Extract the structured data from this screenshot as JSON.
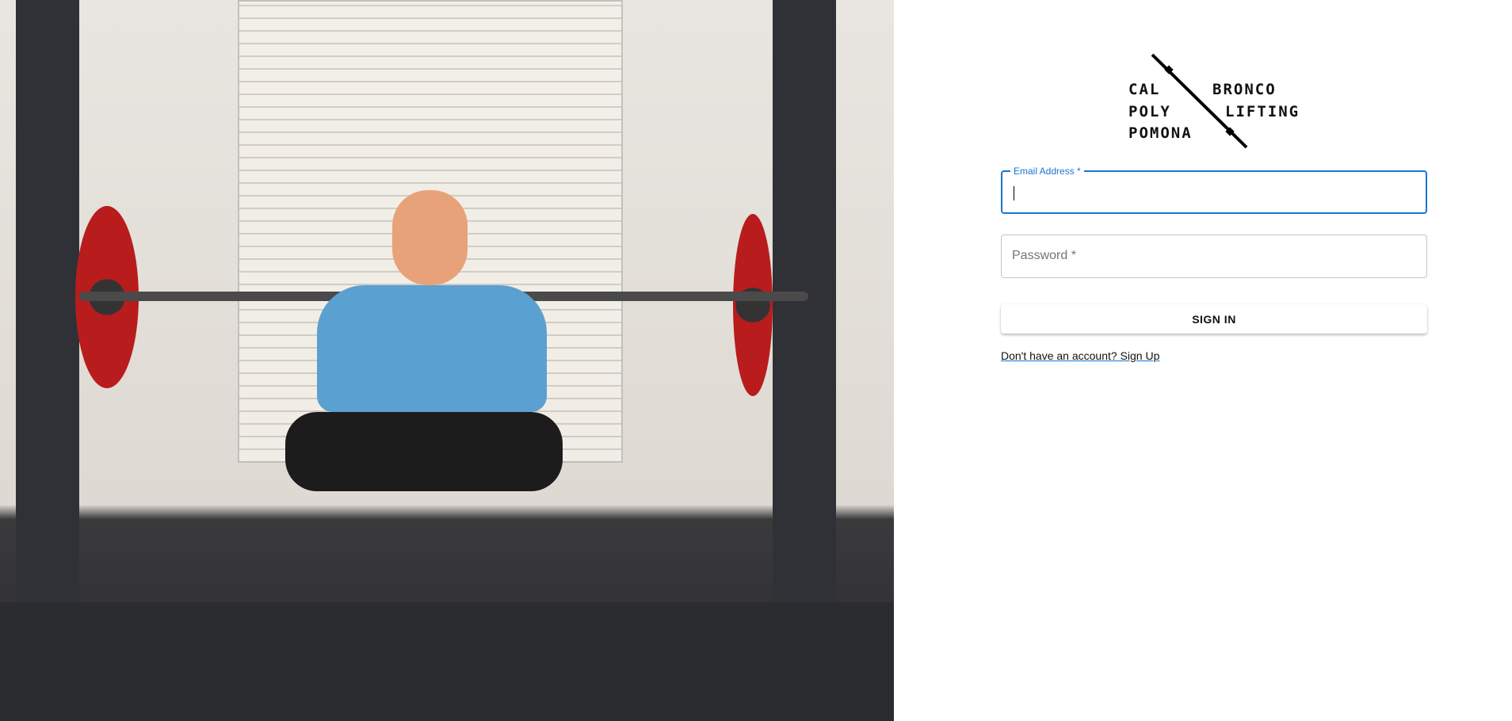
{
  "logo": {
    "line1_left": "CAL",
    "line1_right": "BRONCO",
    "line2_left": "POLY",
    "line2_right": "LIFTING",
    "line3_left": "POMONA"
  },
  "form": {
    "email_label": "Email Address *",
    "email_value": "",
    "password_label": "Password *",
    "password_value": "",
    "sign_in_label": "SIGN IN",
    "signup_link": "Don't have an account? Sign Up"
  },
  "colors": {
    "accent": "#1976d2"
  }
}
